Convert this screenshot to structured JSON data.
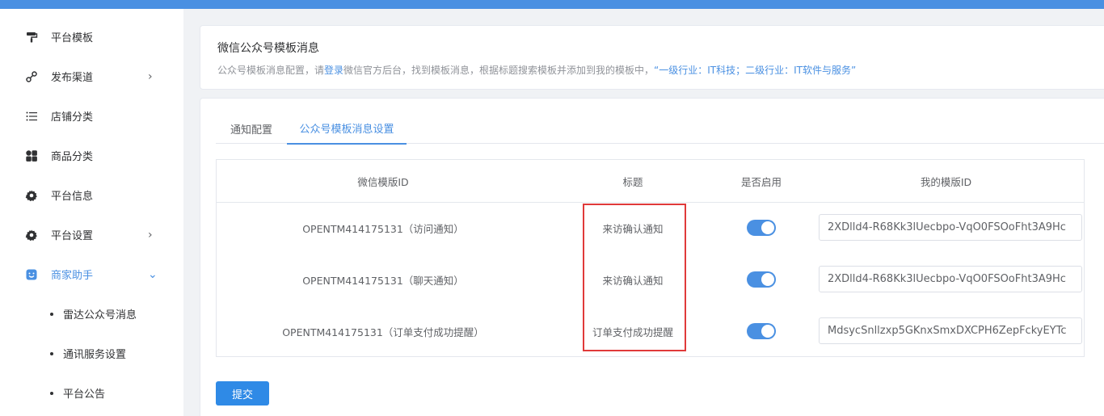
{
  "sidebar": {
    "items": [
      {
        "label": "平台模板",
        "icon": "paint-roller-icon"
      },
      {
        "label": "发布渠道",
        "icon": "channel-link-icon",
        "chevron": "›"
      },
      {
        "label": "店铺分类",
        "icon": "list-icon"
      },
      {
        "label": "商品分类",
        "icon": "category-grid-icon"
      },
      {
        "label": "平台信息",
        "icon": "gear-icon"
      },
      {
        "label": "平台设置",
        "icon": "gear-icon",
        "chevron": "›"
      },
      {
        "label": "商家助手",
        "icon": "smile-face-icon",
        "chevron": "⌄",
        "active": true
      }
    ],
    "sub_items": [
      {
        "label": "雷达公众号消息"
      },
      {
        "label": "通讯服务设置"
      },
      {
        "label": "平台公告"
      }
    ]
  },
  "info_card": {
    "title": "微信公众号模板消息",
    "desc_pre": "公众号模板消息配置，请",
    "desc_link": "登录",
    "desc_mid": "微信官方后台，找到模板消息，根据标题搜索模板并添加到我的模板中，",
    "desc_highlight": "“一级行业：IT科技；二级行业：IT软件与服务”"
  },
  "tabs": [
    {
      "label": "通知配置",
      "active": false
    },
    {
      "label": "公众号模板消息设置",
      "active": true
    }
  ],
  "table": {
    "headers": [
      "微信模版ID",
      "标题",
      "是否启用",
      "我的模版ID"
    ],
    "rows": [
      {
        "template_id": "OPENTM414175131（访问通知）",
        "title": "来访确认通知",
        "enabled": true,
        "my_template_id": "2XDlld4-R68Kk3lUecbpo-VqO0FSOoFht3A9Hc"
      },
      {
        "template_id": "OPENTM414175131（聊天通知）",
        "title": "来访确认通知",
        "enabled": true,
        "my_template_id": "2XDlld4-R68Kk3lUecbpo-VqO0FSOoFht3A9Hc"
      },
      {
        "template_id": "OPENTM414175131（订单支付成功提醒）",
        "title": "订单支付成功提醒",
        "enabled": true,
        "my_template_id": "MdsycSnllzxp5GKnxSmxDXCPH6ZepFckyEYTc"
      }
    ]
  },
  "submit_label": "提交",
  "colors": {
    "accent": "#4a90e2",
    "highlight_box": "#e03a3a"
  }
}
